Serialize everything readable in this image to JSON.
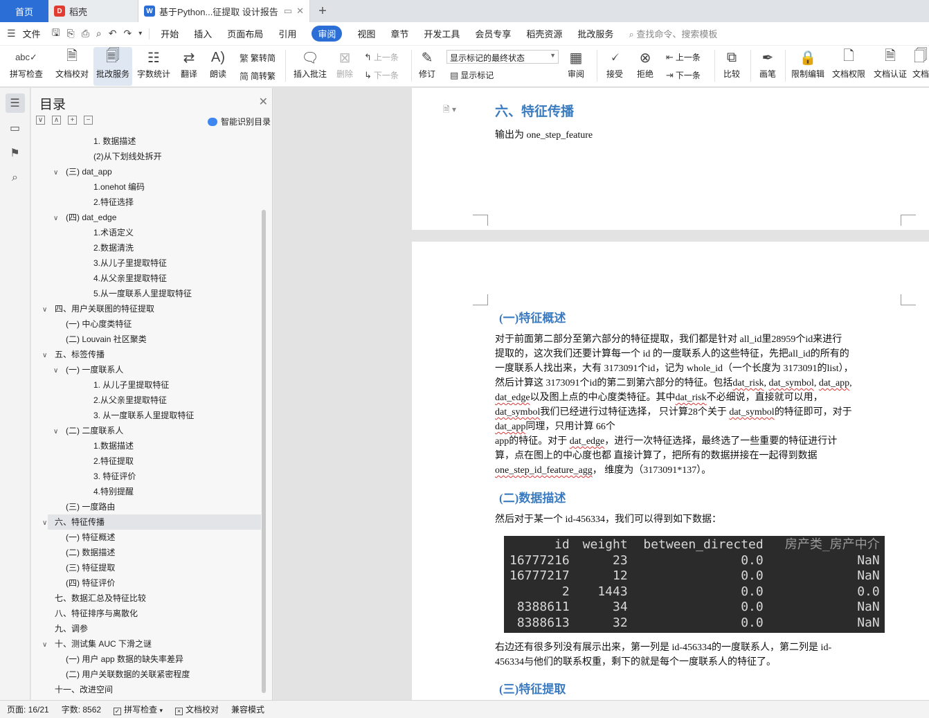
{
  "tabs": {
    "home": "首页",
    "docer": "稻壳",
    "active_doc": "基于Python...征提取 设计报告"
  },
  "menu": {
    "file": "文件",
    "items": [
      "开始",
      "插入",
      "页面布局",
      "引用",
      "审阅",
      "视图",
      "章节",
      "开发工具",
      "会员专享",
      "稻壳资源",
      "批改服务"
    ],
    "active": "审阅",
    "search": "查找命令、搜索模板"
  },
  "ribbon": {
    "spell_check": "拼写检查",
    "doc_proof": "文档校对",
    "correction": "批改服务",
    "word_count": "字数统计",
    "translate": "翻译",
    "read_aloud": "朗读",
    "trad_simp": "繁转简",
    "simp_trad": "简转繁",
    "insert_comment": "插入批注",
    "delete": "删除",
    "prev": "上一条",
    "next": "下一条",
    "track": "修订",
    "markup_state": "显示标记的最终状态",
    "show_markup": "显示标记",
    "review": "审阅",
    "accept": "接受",
    "reject": "拒绝",
    "prev2": "上一条",
    "next2": "下一条",
    "compare": "比较",
    "pen": "画笔",
    "restrict_edit": "限制编辑",
    "doc_permission": "文档权限",
    "doc_cert": "文档认证",
    "doc_more": "文档"
  },
  "toc": {
    "title": "目录",
    "ai_label": "智能识别目录",
    "items": [
      {
        "text": "1. 数据描述",
        "level": 3
      },
      {
        "text": "(2)从下划线处拆开",
        "level": 3
      },
      {
        "text": "(三) dat_app",
        "level": 2,
        "caret": "down"
      },
      {
        "text": "1.onehot 编码",
        "level": 3
      },
      {
        "text": "2.特征选择",
        "level": 3
      },
      {
        "text": "(四) dat_edge",
        "level": 2,
        "caret": "down"
      },
      {
        "text": "1.术语定义",
        "level": 3
      },
      {
        "text": "2.数据清洗",
        "level": 3
      },
      {
        "text": "3.从儿子里提取特征",
        "level": 3
      },
      {
        "text": "4.从父亲里提取特征",
        "level": 3
      },
      {
        "text": "5.从一度联系人里提取特征",
        "level": 3
      },
      {
        "text": "四、用户关联图的特征提取",
        "level": 1,
        "caret": "down"
      },
      {
        "text": "(一) 中心度类特征",
        "level": 2
      },
      {
        "text": "(二) Louvain 社区聚类",
        "level": 2
      },
      {
        "text": "五、标签传播",
        "level": 1,
        "caret": "down"
      },
      {
        "text": "(一) 一度联系人",
        "level": 2,
        "caret": "down"
      },
      {
        "text": "1. 从儿子里提取特征",
        "level": 3
      },
      {
        "text": "2.从父亲里提取特征",
        "level": 3
      },
      {
        "text": "3. 从一度联系人里提取特征",
        "level": 3
      },
      {
        "text": "(二) 二度联系人",
        "level": 2,
        "caret": "down"
      },
      {
        "text": "1.数据描述",
        "level": 3
      },
      {
        "text": "2.特征提取",
        "level": 3
      },
      {
        "text": "3. 特征评价",
        "level": 3
      },
      {
        "text": "4.特别提醒",
        "level": 3
      },
      {
        "text": "(三) 一度路由",
        "level": 2
      },
      {
        "text": "六、特征传播",
        "level": 1,
        "caret": "down",
        "selected": true
      },
      {
        "text": "(一) 特征概述",
        "level": 2
      },
      {
        "text": "(二) 数据描述",
        "level": 2
      },
      {
        "text": "(三) 特征提取",
        "level": 2
      },
      {
        "text": "(四) 特征评价",
        "level": 2
      },
      {
        "text": "七、数据汇总及特征比较",
        "level": 1
      },
      {
        "text": "八、特征排序与离散化",
        "level": 1
      },
      {
        "text": "九、调参",
        "level": 1
      },
      {
        "text": "十、测试集 AUC 下滑之谜",
        "level": 1,
        "caret": "down"
      },
      {
        "text": "(一) 用户 app 数据的缺失率差异",
        "level": 2
      },
      {
        "text": "(二) 用户关联数据的关联紧密程度",
        "level": 2
      },
      {
        "text": "十一、改进空间",
        "level": 1
      }
    ]
  },
  "document": {
    "page1": {
      "heading": "六、特征传播",
      "line": "输出为 one_step_feature"
    },
    "page2": {
      "sub1": "(一)特征概述",
      "para1": [
        [
          {
            "t": "对于前面第二部分至第六部分的特征提取，我们都是针对 all_id里28959个id来进行"
          }
        ],
        [
          {
            "t": "提取的，这次我们还要计算每一个 id 的一度联系人的这些特征，先把all_id的所有的"
          }
        ],
        [
          {
            "t": "一度联系人找出来，大有 3173091个id，记为 whole_id（一个长度为 3173091的list），"
          }
        ],
        [
          {
            "t": "然后计算这 3173091个id的第二到第六部分的特征。包括"
          },
          {
            "t": "dat_risk",
            "w": 1
          },
          {
            "t": ", "
          },
          {
            "t": "dat_symbol",
            "w": 1
          },
          {
            "t": ", "
          },
          {
            "t": "dat_app",
            "w": 1
          },
          {
            "t": ","
          }
        ],
        [
          {
            "t": "dat_edge",
            "w": 1
          },
          {
            "t": "以及图上点的中心度类特征。其中"
          },
          {
            "t": "dat_risk",
            "w": 1
          },
          {
            "t": "不必细说，直接就可以用，"
          }
        ],
        [
          {
            "t": "dat_symbol",
            "w": 1
          },
          {
            "t": "我们已经进行过特征选择，  只计算28个关于 "
          },
          {
            "t": "dat_symbol",
            "w": 1
          },
          {
            "t": "的特征即可，对于"
          }
        ],
        [
          {
            "t": "dat_app",
            "w": 1
          },
          {
            "t": "同理，只用计算 66个"
          }
        ],
        [
          {
            "t": "app的特征。对于 "
          },
          {
            "t": "dat_edge",
            "w": 1
          },
          {
            "t": "，进行一次特征选择，最终选了一些重要的特征进行计"
          }
        ],
        [
          {
            "t": "算，点在图上的中心度也都 直接计算了，把所有的数据拼接在一起得到数据"
          }
        ],
        [
          {
            "t": "one_step_id_feature_agg",
            "w": 1
          },
          {
            "t": "，  维度为（3173091*137）。"
          }
        ]
      ],
      "sub2": "(二)数据描述",
      "para2": "然后对于某一个 id-456334，我们可以得到如下数据：",
      "table": {
        "headers": [
          "id",
          "weight",
          "between_directed",
          "房产类_房产中介"
        ],
        "rows": [
          [
            "16777216",
            "23",
            "0.0",
            "NaN"
          ],
          [
            "16777217",
            "12",
            "0.0",
            "NaN"
          ],
          [
            "2",
            "1443",
            "0.0",
            "0.0"
          ],
          [
            "8388611",
            "34",
            "0.0",
            "NaN"
          ],
          [
            "8388613",
            "32",
            "0.0",
            "NaN"
          ]
        ]
      },
      "para3": [
        "右边还有很多列没有展示出来，第一列是 id-456334的一度联系人，第二列是 id-",
        "456334与他们的联系权重，剩下的就是每个一度联系人的特征了。"
      ],
      "sub3": "(三)特征提取"
    }
  },
  "status": {
    "page": "页面: 16/21",
    "words": "字数: 8562",
    "spell": "拼写检查",
    "proof": "文档校对",
    "mode": "兼容模式"
  },
  "colors": {
    "accent": "#2b6fd6",
    "heading": "#3a7bc0",
    "code_bg": "#2b2b2b"
  }
}
